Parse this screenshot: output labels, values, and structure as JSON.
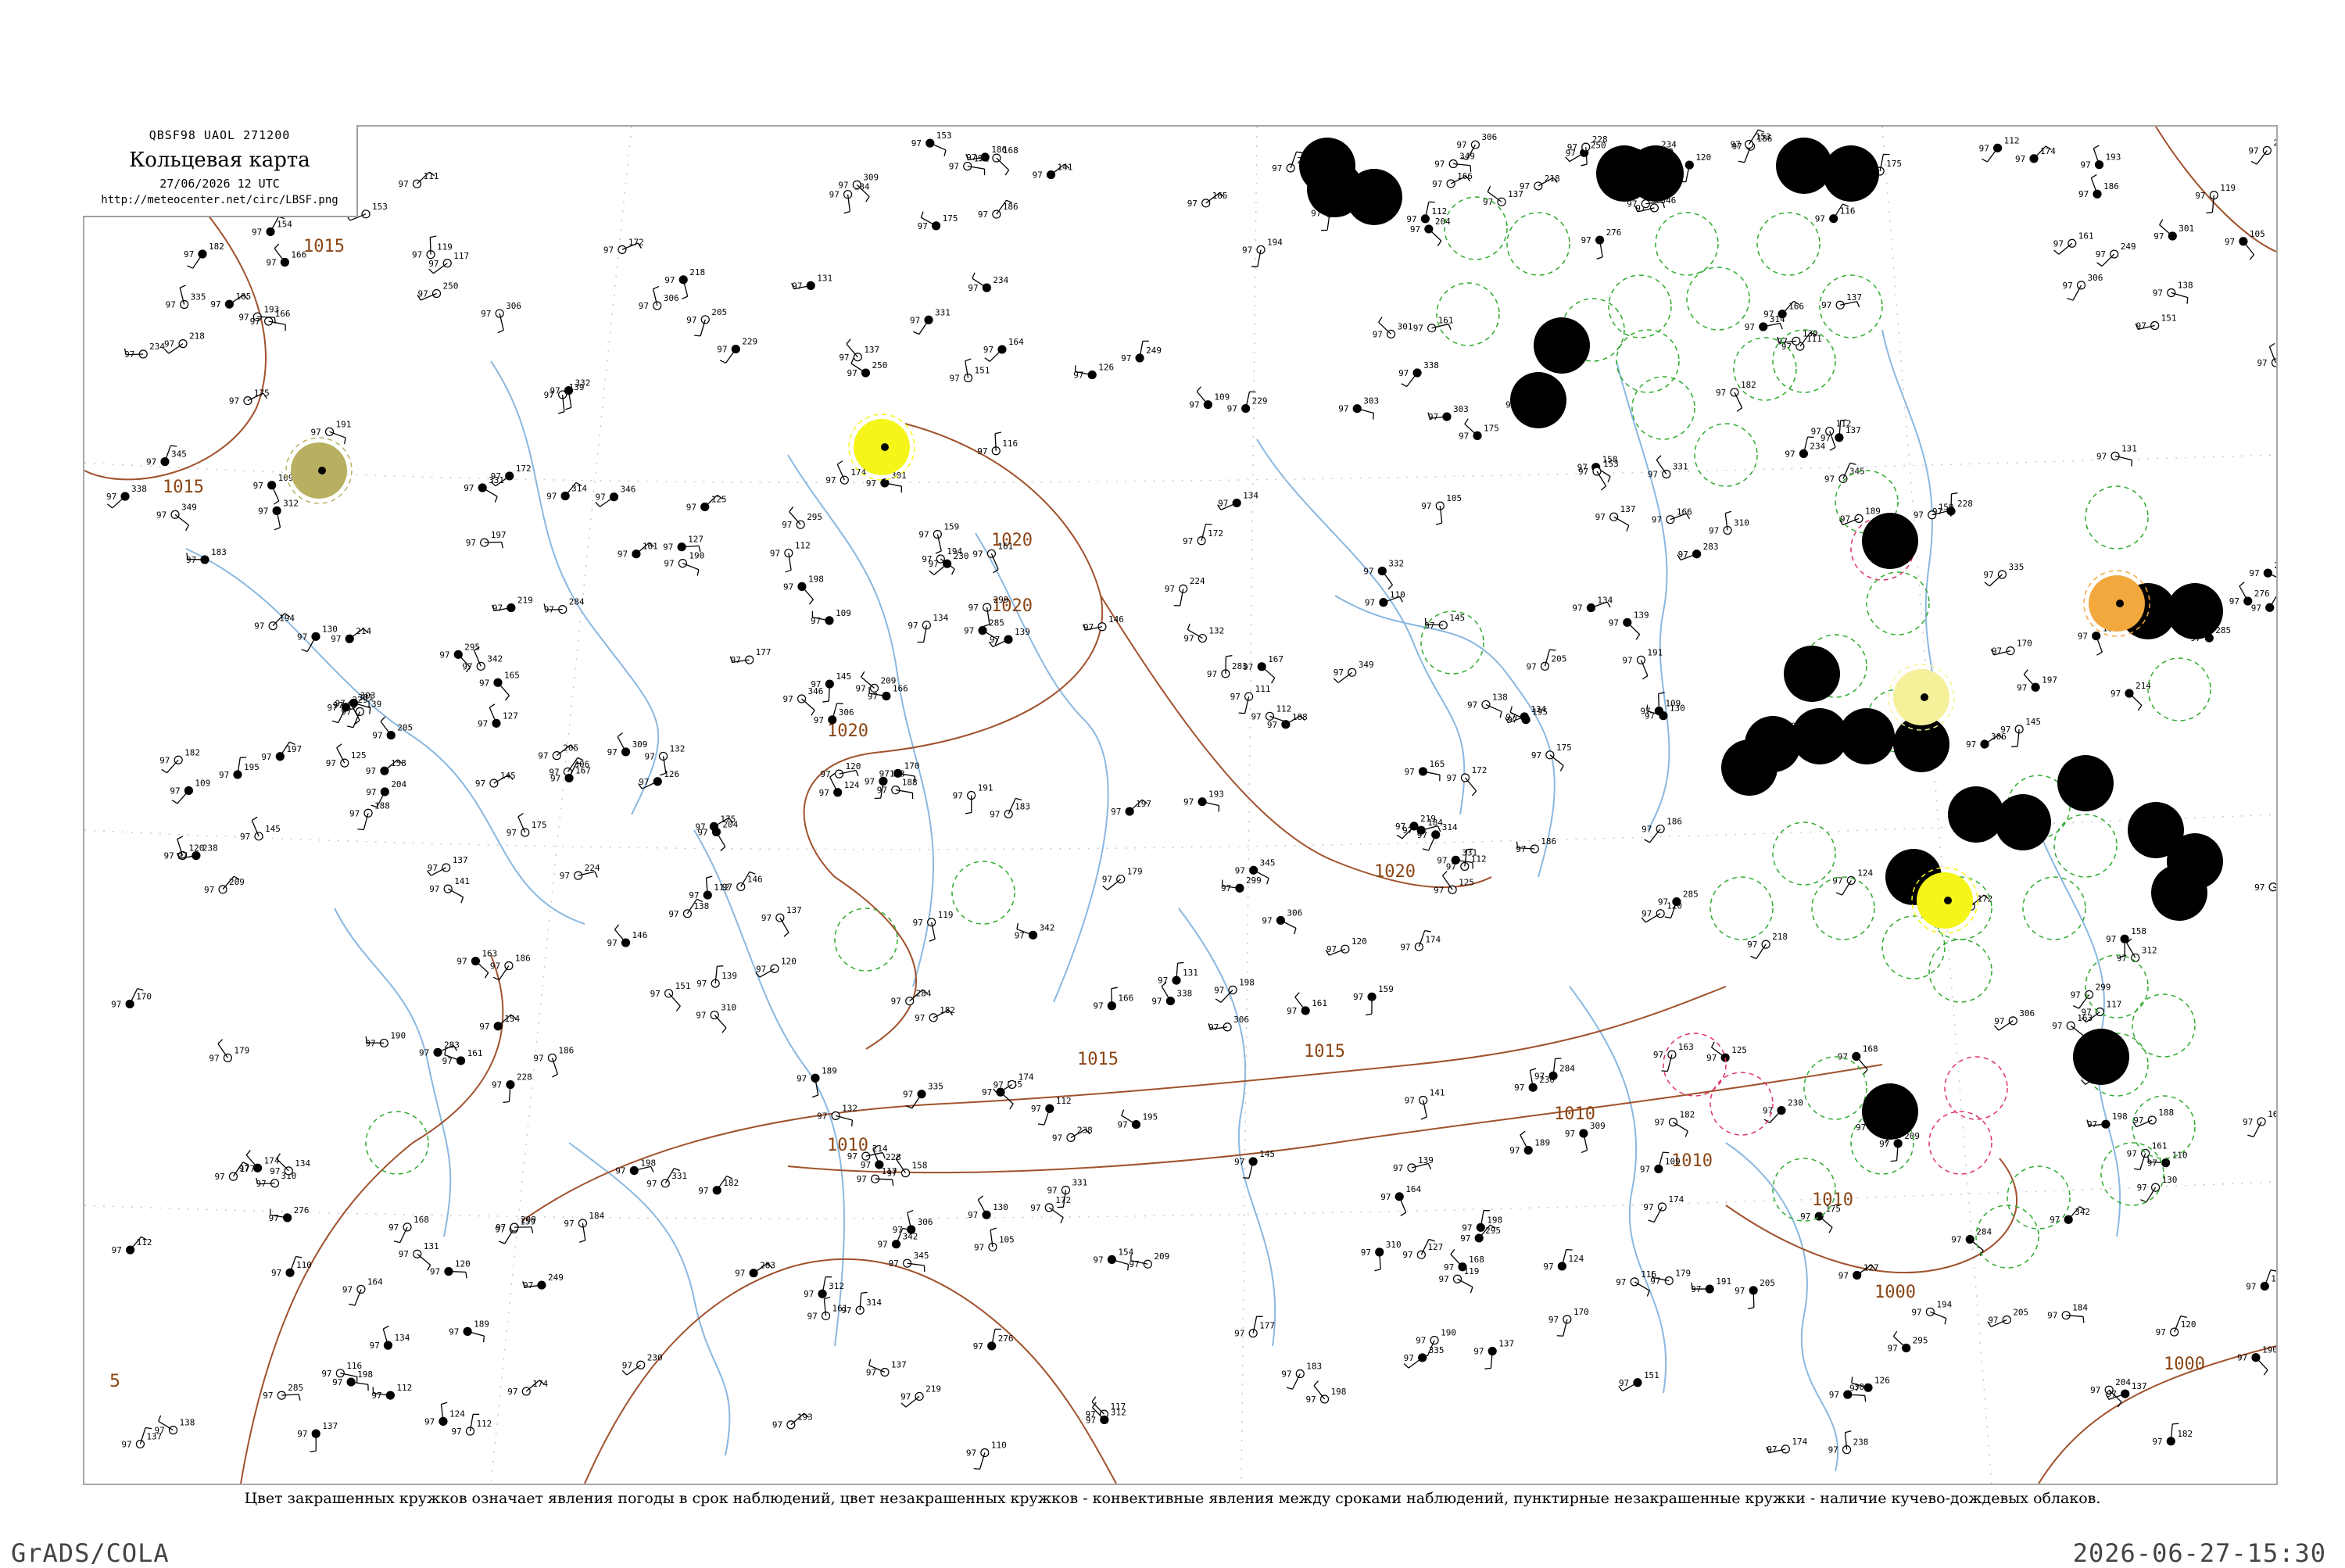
{
  "header": {
    "code": "QBSF98  UAOL  271200",
    "title": "Кольцевая карта",
    "date": "27/06/2026 12 UTC",
    "url": "http://meteocenter.net/circ/LBSF.png"
  },
  "caption": "Цвет закрашенных кружков означает явления погоды в срок наблюдений, цвет незакрашенных кружков - конвективные явления между сроками наблюдений, пунктирные незакрашенные кружки - наличие кучево-дождевых облаков.",
  "footer": {
    "left": "GrADS/COLA",
    "right": "2026-06-27-15:30"
  },
  "corner_digit": "5",
  "isobar_labels": [
    "1015",
    "1015",
    "1020",
    "1020",
    "1020",
    "1020",
    "1015",
    "1010",
    "1010",
    "1000",
    "1000",
    "1015",
    "1010",
    "1010"
  ],
  "colors": {
    "isobar": "#a0522d",
    "river": "#8ab8e0",
    "frame": "#a8a8a8",
    "storm_red": "#e8194f",
    "rain_green": "#22b422",
    "yellow": "#f5f51a",
    "orange": "#f2a83c",
    "olive": "#b8b060",
    "pale_yellow": "#f5f09a",
    "cb_green": "#2eaa2e",
    "cb_red": "#e0306a"
  },
  "station_values": [
    "197",
    "154",
    "159",
    "139",
    "177",
    "182",
    "194",
    "301",
    "183",
    "132",
    "164",
    "131",
    "117",
    "172",
    "198",
    "193",
    "312",
    "306",
    "161",
    "188",
    "112",
    "146",
    "342",
    "310",
    "209",
    "283",
    "345",
    "110",
    "229",
    "299",
    "120",
    "145",
    "145",
    "306",
    "127",
    "130",
    "120",
    "168",
    "158",
    "295",
    "335",
    "219",
    "161",
    "137",
    "124",
    "276",
    "175",
    "166",
    "109",
    "186",
    "139",
    "230",
    "346",
    "116",
    "214",
    "285",
    "205",
    "134",
    "119",
    "170",
    "174",
    "105",
    "314",
    "186",
    "184",
    "182",
    "204",
    "189",
    "174",
    "250",
    "163",
    "137",
    "137",
    "175",
    "125",
    "190",
    "228",
    "234",
    "138",
    "331",
    "151",
    "284",
    "309",
    "218",
    "153",
    "112",
    "191",
    "112",
    "331",
    "141",
    "109",
    "349",
    "134",
    "165",
    "179",
    "195",
    "338",
    "303",
    "172",
    "332",
    "198",
    "166",
    "205",
    "111",
    "249",
    "238",
    "167",
    "126",
    "224",
    "306"
  ]
}
